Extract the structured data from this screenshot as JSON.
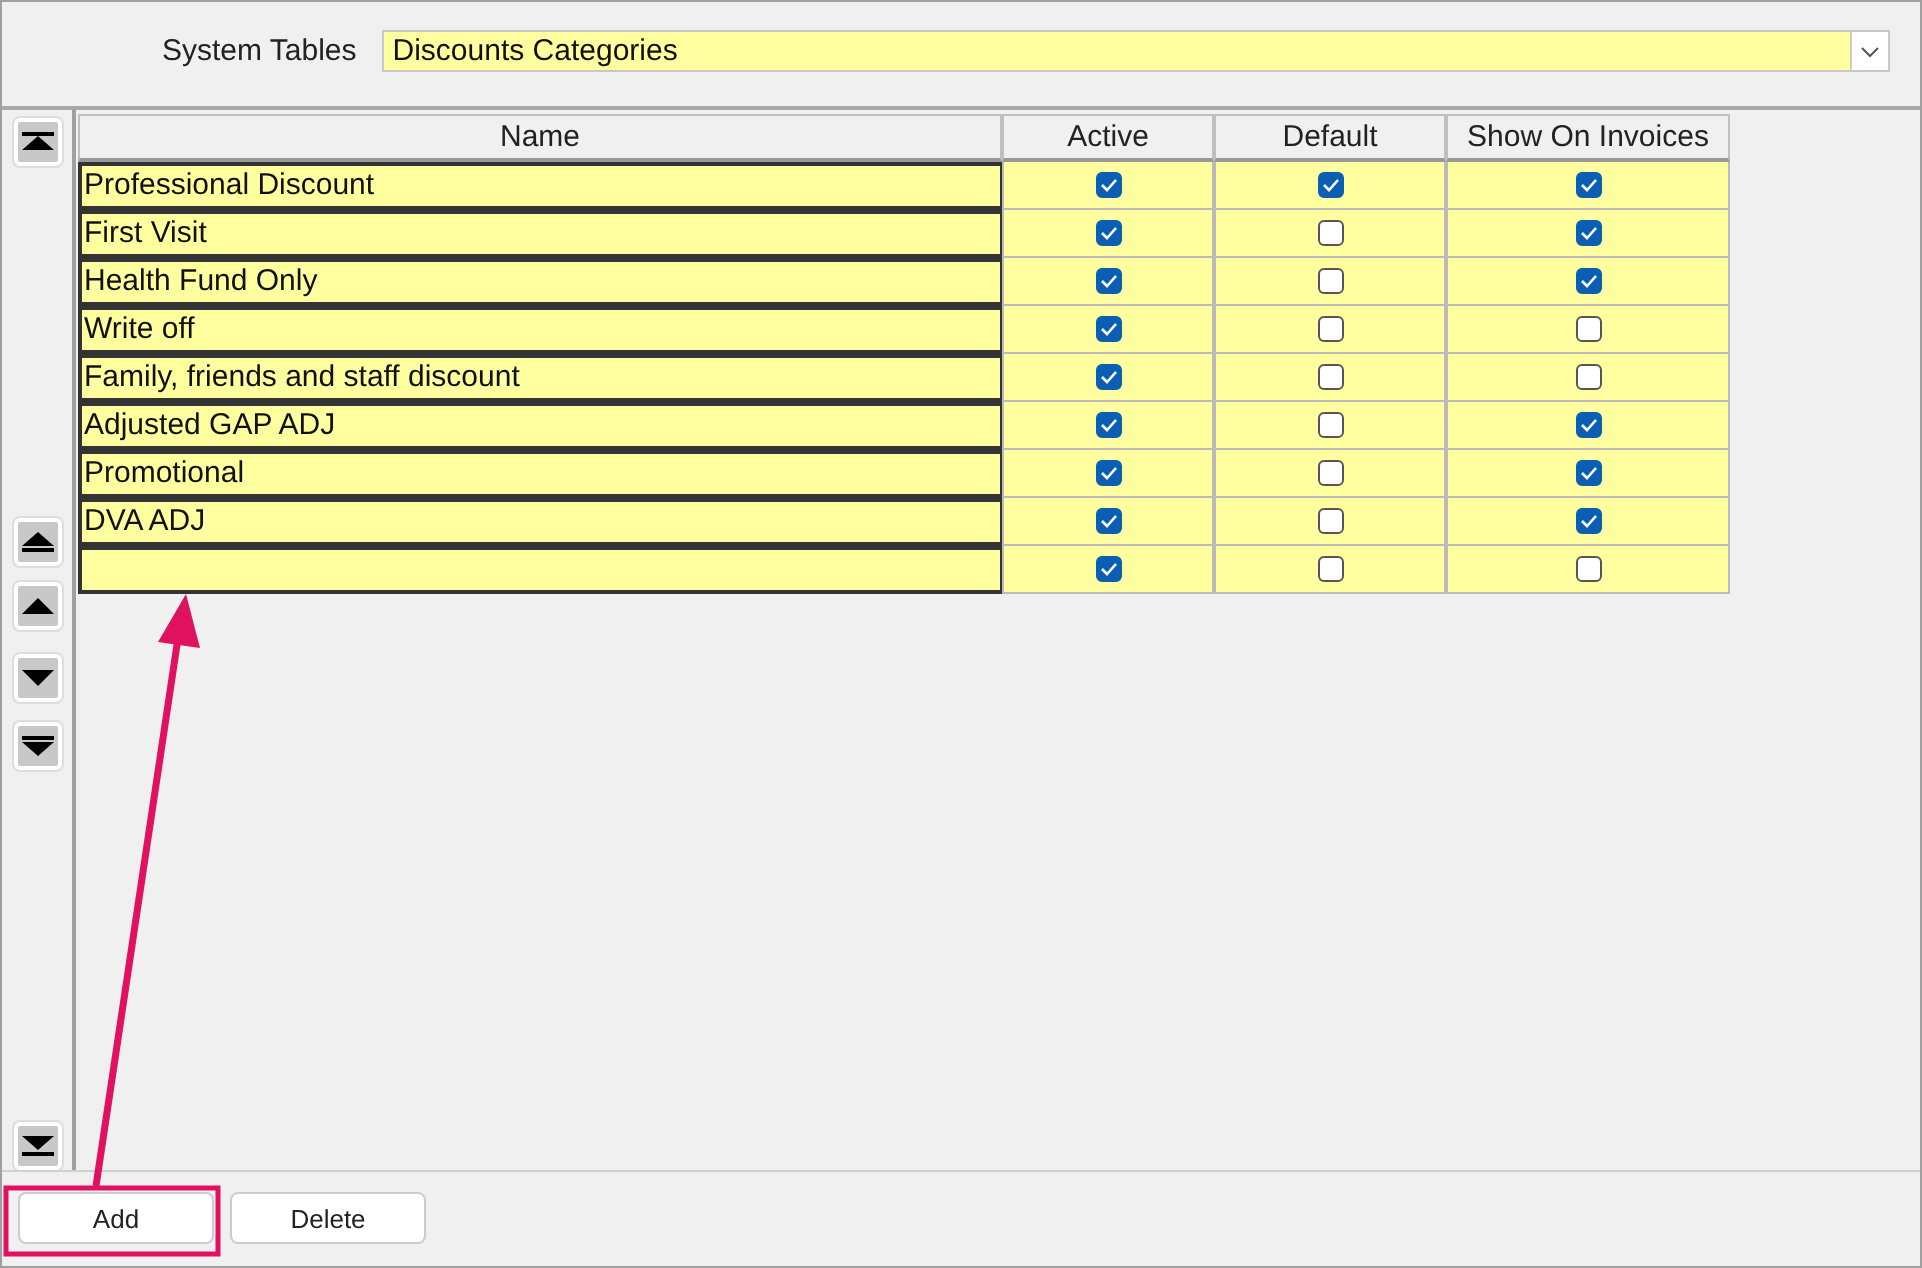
{
  "header": {
    "label": "System Tables",
    "combo_value": "Discounts Categories"
  },
  "table": {
    "columns": [
      "Name",
      "Active",
      "Default",
      "Show On Invoices"
    ],
    "rows": [
      {
        "name": "Professional Discount",
        "active": true,
        "default": true,
        "show_on_invoices": true
      },
      {
        "name": "First Visit",
        "active": true,
        "default": false,
        "show_on_invoices": true
      },
      {
        "name": "Health Fund Only",
        "active": true,
        "default": false,
        "show_on_invoices": true
      },
      {
        "name": "Write off",
        "active": true,
        "default": false,
        "show_on_invoices": false
      },
      {
        "name": "Family, friends and staff discount",
        "active": true,
        "default": false,
        "show_on_invoices": false
      },
      {
        "name": "Adjusted GAP ADJ",
        "active": true,
        "default": false,
        "show_on_invoices": true
      },
      {
        "name": "Promotional",
        "active": true,
        "default": false,
        "show_on_invoices": true
      },
      {
        "name": "DVA ADJ",
        "active": true,
        "default": false,
        "show_on_invoices": true
      },
      {
        "active": true,
        "default": false,
        "show_on_invoices": false
      }
    ]
  },
  "buttons": [
    "Add",
    "Delete"
  ]
}
